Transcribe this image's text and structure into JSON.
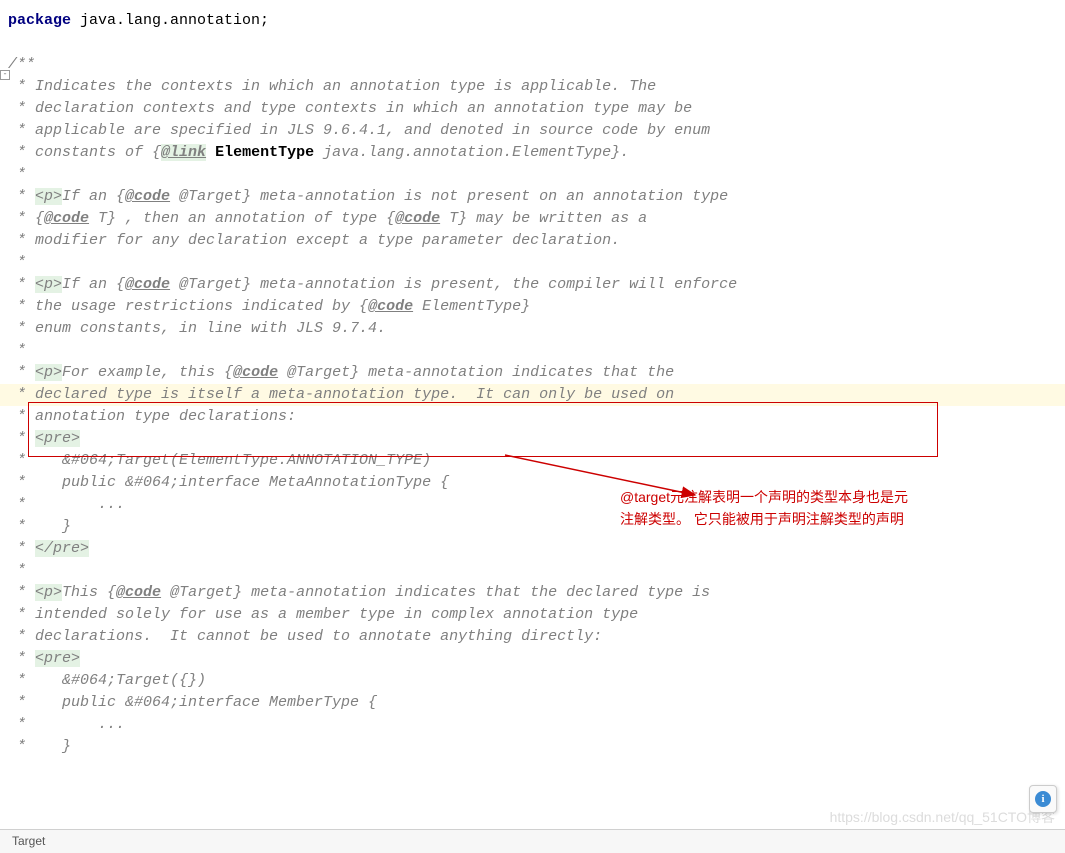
{
  "code": {
    "package_keyword": "package",
    "package_name": " java.lang.annotation;",
    "doc_open": "/**",
    "l1": " * Indicates the contexts in which an annotation type is applicable. The",
    "l2": " * declaration contexts and type contexts in which an annotation type may be",
    "l3": " * applicable are specified in JLS 9.6.4.1, and denoted in source code by enum",
    "l4a": " * constants of {",
    "l4_link": "@link",
    "l4_sp": " ",
    "l4_type": "ElementType",
    "l4b": " java.lang.annotation.ElementType}.",
    "star": " *",
    "l6a": " * ",
    "l6_p": "<p>",
    "l6b": "If an {",
    "l6_code": "@code",
    "l6c": " @Target} meta-annotation is not present on an annotation type",
    "l7a": " * {",
    "l7_code": "@code",
    "l7b": " T} , then an annotation of type {",
    "l7_code2": "@code",
    "l7c": " T} may be written as a",
    "l8": " * modifier for any declaration except a type parameter declaration.",
    "l10a": " * ",
    "l10_p": "<p>",
    "l10b": "If an {",
    "l10_code": "@code",
    "l10c": " @Target} meta-annotation is present, the compiler will enforce",
    "l11a": " * the usage restrictions indicated by {",
    "l11_code": "@code",
    "l11b": " ElementType}",
    "l12": " * enum constants, in line with JLS 9.7.4.",
    "l14a": " * ",
    "l14_p": "<p>",
    "l14b": "For example, this {",
    "l14_code": "@code",
    "l14c": " @Target} meta-annotation indicates that the",
    "l15": " * declared type is itself a meta-annotation type.  It can only be used on",
    "l16": " * annotation type declarations:",
    "l17a": " * ",
    "l17_pre": "<pre>",
    "l18": " *    &#064;Target(ElementType.ANNOTATION_TYPE)",
    "l19": " *    public &#064;interface MetaAnnotationType {",
    "l20": " *        ...",
    "l21": " *    }",
    "l22a": " * ",
    "l22_pre": "</pre>",
    "l24a": " * ",
    "l24_p": "<p>",
    "l24b": "This {",
    "l24_code": "@code",
    "l24c": " @Target} meta-annotation indicates that the declared type is",
    "l25": " * intended solely for use as a member type in complex annotation type",
    "l26": " * declarations.  It cannot be used to annotate anything directly:",
    "l27a": " * ",
    "l27_pre": "<pre>",
    "l28": " *    &#064;Target({})",
    "l29": " *    public &#064;interface MemberType {",
    "l30": " *        ...",
    "l31": " *    }"
  },
  "annotation": {
    "line1": "@target元注解表明一个声明的类型本身也是元",
    "line2": "注解类型。 它只能被用于声明注解类型的声明"
  },
  "watermark": {
    "text1": "https://blog.csdn.net/qq_51CTO博客"
  },
  "status": {
    "text": "Target"
  },
  "info": {
    "glyph": "i"
  },
  "fold": {
    "glyph": "-"
  }
}
